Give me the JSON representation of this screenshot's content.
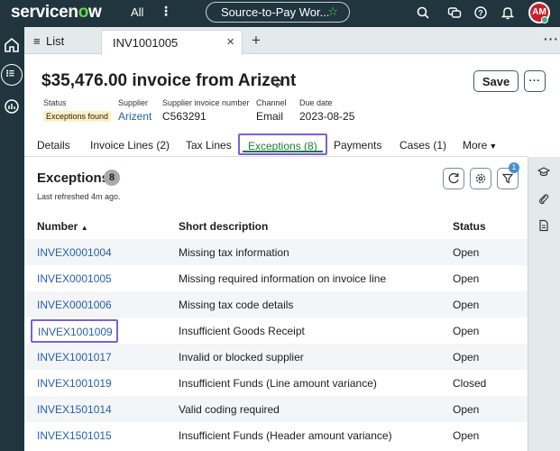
{
  "topbar": {
    "logo_main": "servicen",
    "logo_o": "o",
    "logo_tail": "w",
    "all_label": "All",
    "workspace": "Source-to-Pay Wor...",
    "avatar_initials": "AM"
  },
  "tabstrip": {
    "list_label": "List",
    "record_tab": "INV1001005"
  },
  "record": {
    "title": "$35,476.00 invoice from Arizent",
    "save_label": "Save",
    "fields": [
      {
        "label": "Status",
        "value": "Exceptions found"
      },
      {
        "label": "Supplier",
        "value": "Arizent"
      },
      {
        "label": "Supplier invoice number",
        "value": "C563291"
      },
      {
        "label": "Channel",
        "value": "Email"
      },
      {
        "label": "Due date",
        "value": "2023-08-25"
      }
    ]
  },
  "record_tabs": [
    {
      "label": "Details"
    },
    {
      "label": "Invoice Lines (2)"
    },
    {
      "label": "Tax Lines"
    },
    {
      "label": "Exceptions (8)",
      "active": true
    },
    {
      "label": "Payments"
    },
    {
      "label": "Cases (1)"
    },
    {
      "label": "More"
    }
  ],
  "exceptions": {
    "title": "Exceptions",
    "count": "8",
    "last_refreshed": "Last refreshed 4m ago.",
    "filter_count": "1",
    "columns": {
      "number": "Number",
      "description": "Short description",
      "status": "Status"
    },
    "rows": [
      {
        "number": "INVEX0001004",
        "description": "Missing tax information",
        "status": "Open"
      },
      {
        "number": "INVEX0001005",
        "description": "Missing required information on invoice line",
        "status": "Open"
      },
      {
        "number": "INVEX0001006",
        "description": "Missing tax code details",
        "status": "Open"
      },
      {
        "number": "INVEX1001009",
        "description": "Insufficient Goods Receipt",
        "status": "Open"
      },
      {
        "number": "INVEX1001017",
        "description": "Invalid or blocked supplier",
        "status": "Open"
      },
      {
        "number": "INVEX1001019",
        "description": "Insufficient Funds (Line amount variance)",
        "status": "Closed"
      },
      {
        "number": "INVEX1501014",
        "description": "Valid coding required",
        "status": "Open"
      },
      {
        "number": "INVEX1501015",
        "description": "Insufficient Funds (Header amount variance)",
        "status": "Open"
      }
    ]
  },
  "colors": {
    "topbar_bg": "#20353d",
    "accent_green": "#62d84e",
    "link_blue": "#2660b0",
    "highlight_purple": "#7b61d6"
  },
  "icons": [
    "search-icon",
    "chat-icon",
    "help-icon",
    "bell-icon",
    "home-icon",
    "menu-icon",
    "analytics-icon",
    "tag-icon",
    "refresh-icon",
    "gear-icon",
    "filter-icon",
    "graduation-cap-icon",
    "paperclip-icon",
    "document-icon",
    "star-icon"
  ]
}
